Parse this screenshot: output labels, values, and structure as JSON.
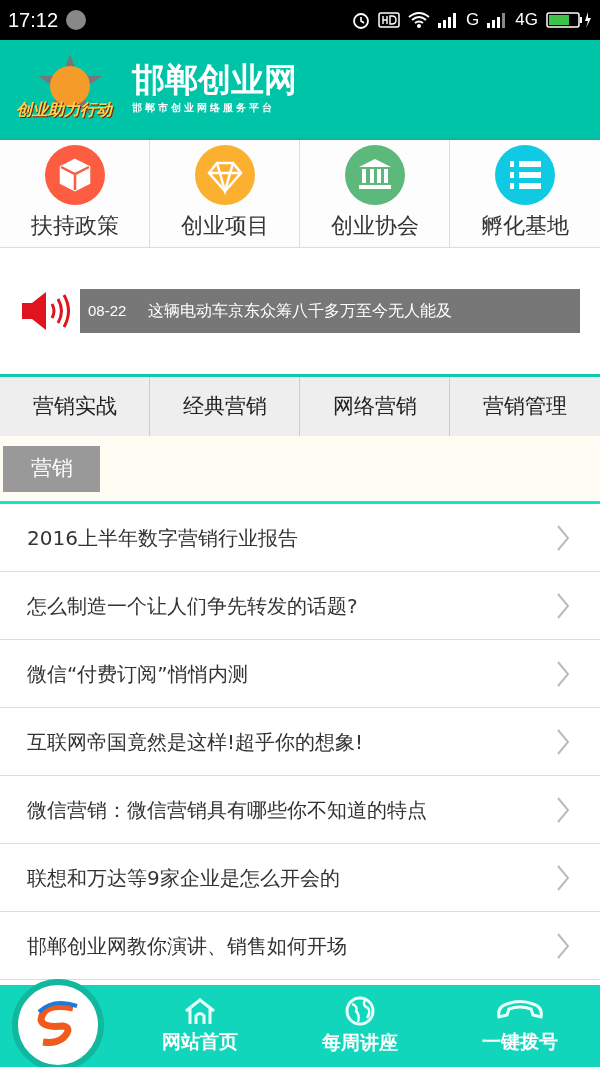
{
  "status_bar": {
    "time": "17:12",
    "network_1": "G",
    "network_2": "4G"
  },
  "header": {
    "logo_text": "创业助力行动",
    "title": "邯郸创业网",
    "subtitle": "邯郸市创业网络服务平台"
  },
  "categories": [
    {
      "label": "扶持政策",
      "color": "#fc5c3f",
      "kind": "cube"
    },
    {
      "label": "创业项目",
      "color": "#fbb12f",
      "kind": "diamond"
    },
    {
      "label": "创业协会",
      "color": "#5db87b",
      "kind": "bank"
    },
    {
      "label": "孵化基地",
      "color": "#10c9e3",
      "kind": "list"
    }
  ],
  "ticker": {
    "date": "08-22",
    "headline": "这辆电动车京东众筹八千多万至今无人能及"
  },
  "tabs": [
    {
      "label": "营销实战",
      "selected": false
    },
    {
      "label": "经典营销",
      "selected": false
    },
    {
      "label": "网络营销",
      "selected": false
    },
    {
      "label": "营销管理",
      "selected": false
    }
  ],
  "section_tag": "营销",
  "articles": [
    "2016上半年数字营销行业报告",
    "怎么制造一个让人们争先转发的话题?",
    "微信“付费订阅”悄悄内测",
    "互联网帝国竟然是这样!超乎你的想象!",
    "微信营销：微信营销具有哪些你不知道的特点",
    "联想和万达等9家企业是怎么开会的",
    "邯郸创业网教你演讲、销售如何开场"
  ],
  "bottom_nav": [
    {
      "label": "网站首页",
      "kind": "home"
    },
    {
      "label": "每周讲座",
      "kind": "globe"
    },
    {
      "label": "一键拨号",
      "kind": "phone"
    }
  ]
}
